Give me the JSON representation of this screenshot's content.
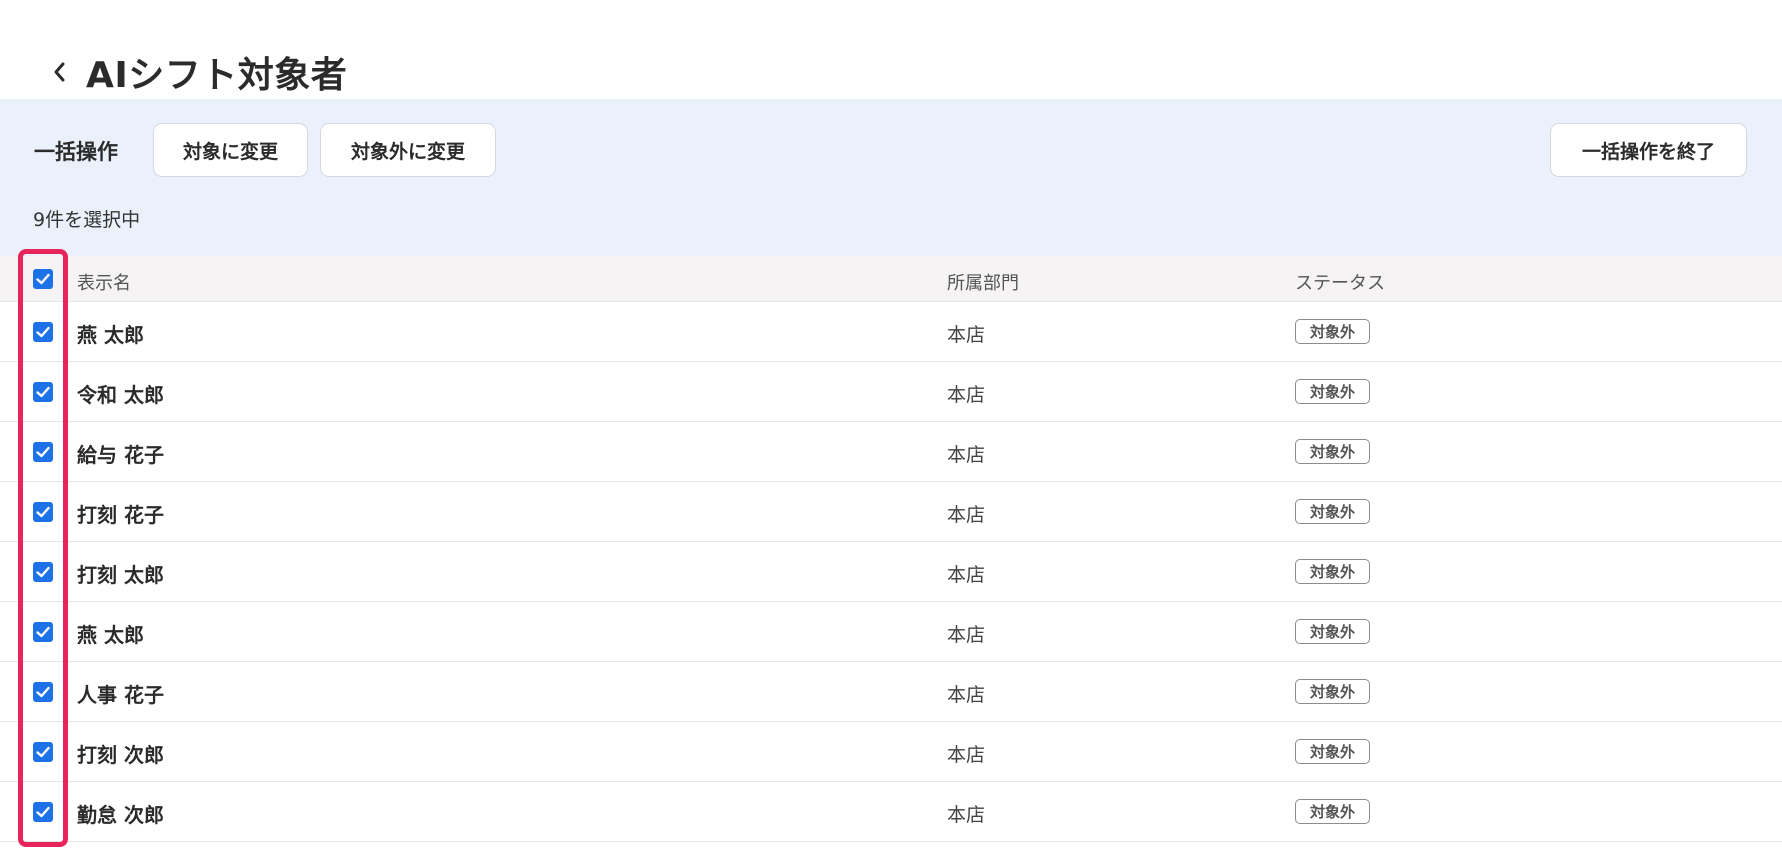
{
  "header": {
    "back_icon": "chevron-left-icon",
    "title": "AIシフト対象者"
  },
  "bulk": {
    "label": "一括操作",
    "btn_target": "対象に変更",
    "btn_nontarget": "対象外に変更",
    "btn_end": "一括操作を終了",
    "selected_count": "9件を選択中"
  },
  "table": {
    "columns": {
      "name": "表示名",
      "dept": "所属部門",
      "status": "ステータス"
    },
    "select_all_checked": true,
    "rows": [
      {
        "name": "燕 太郎",
        "dept": "本店",
        "status": "対象外",
        "checked": true
      },
      {
        "name": "令和 太郎",
        "dept": "本店",
        "status": "対象外",
        "checked": true
      },
      {
        "name": "給与 花子",
        "dept": "本店",
        "status": "対象外",
        "checked": true
      },
      {
        "name": "打刻 花子",
        "dept": "本店",
        "status": "対象外",
        "checked": true
      },
      {
        "name": "打刻 太郎",
        "dept": "本店",
        "status": "対象外",
        "checked": true
      },
      {
        "name": "燕 太郎",
        "dept": "本店",
        "status": "対象外",
        "checked": true
      },
      {
        "name": "人事 花子",
        "dept": "本店",
        "status": "対象外",
        "checked": true
      },
      {
        "name": "打刻 次郎",
        "dept": "本店",
        "status": "対象外",
        "checked": true
      },
      {
        "name": "勤怠 次郎",
        "dept": "本店",
        "status": "対象外",
        "checked": true
      }
    ]
  },
  "colors": {
    "accent": "#1d72e8",
    "bulk_bg": "#eaf1fb",
    "highlight": "#e8245c"
  }
}
